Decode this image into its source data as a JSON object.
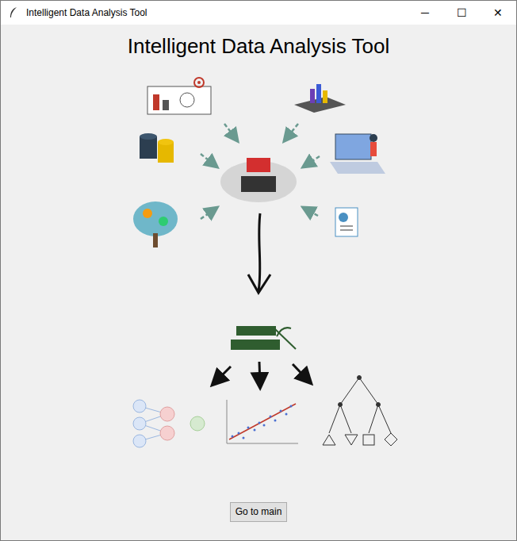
{
  "window": {
    "title": "Intelligent Data Analysis Tool",
    "controls": [
      "─",
      "☐",
      "✕"
    ]
  },
  "heading": "Intelligent Data Analysis Tool",
  "buttons": [
    "Go to main"
  ]
}
